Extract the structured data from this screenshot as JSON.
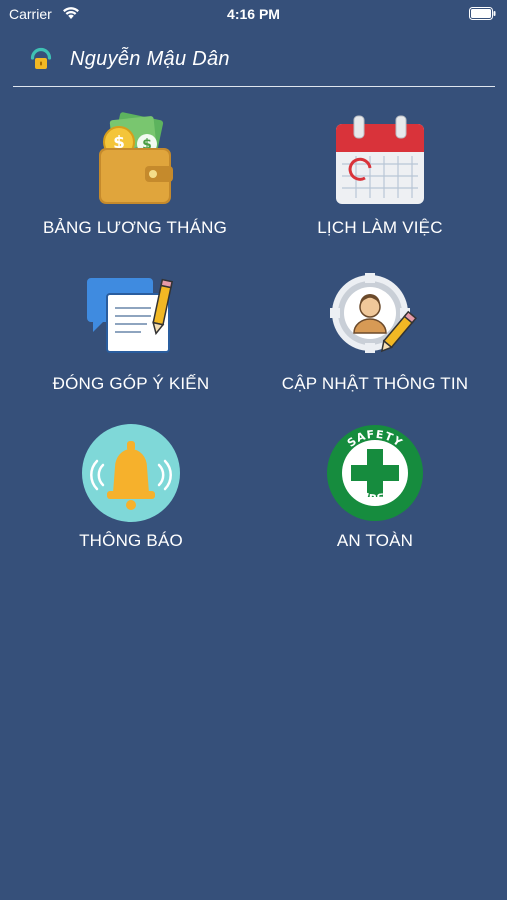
{
  "status_bar": {
    "carrier": "Carrier",
    "time": "4:16 PM"
  },
  "header": {
    "user_name": "Nguyễn Mậu Dân",
    "icon": "logout-icon"
  },
  "menu": [
    {
      "label": "BẢNG LƯƠNG THÁNG",
      "icon": "wallet-money-icon"
    },
    {
      "label": "LỊCH LÀM VIỆC",
      "icon": "calendar-icon"
    },
    {
      "label": "ĐÓNG GÓP Ý KIẾN",
      "icon": "feedback-document-icon"
    },
    {
      "label": "CẬP NHẬT THÔNG TIN",
      "icon": "profile-gear-icon"
    },
    {
      "label": "THÔNG BÁO",
      "icon": "bell-icon"
    },
    {
      "label": "AN TOÀN",
      "icon": "safety-first-icon"
    }
  ],
  "colors": {
    "background": "#36507a",
    "text": "#ffffff"
  }
}
